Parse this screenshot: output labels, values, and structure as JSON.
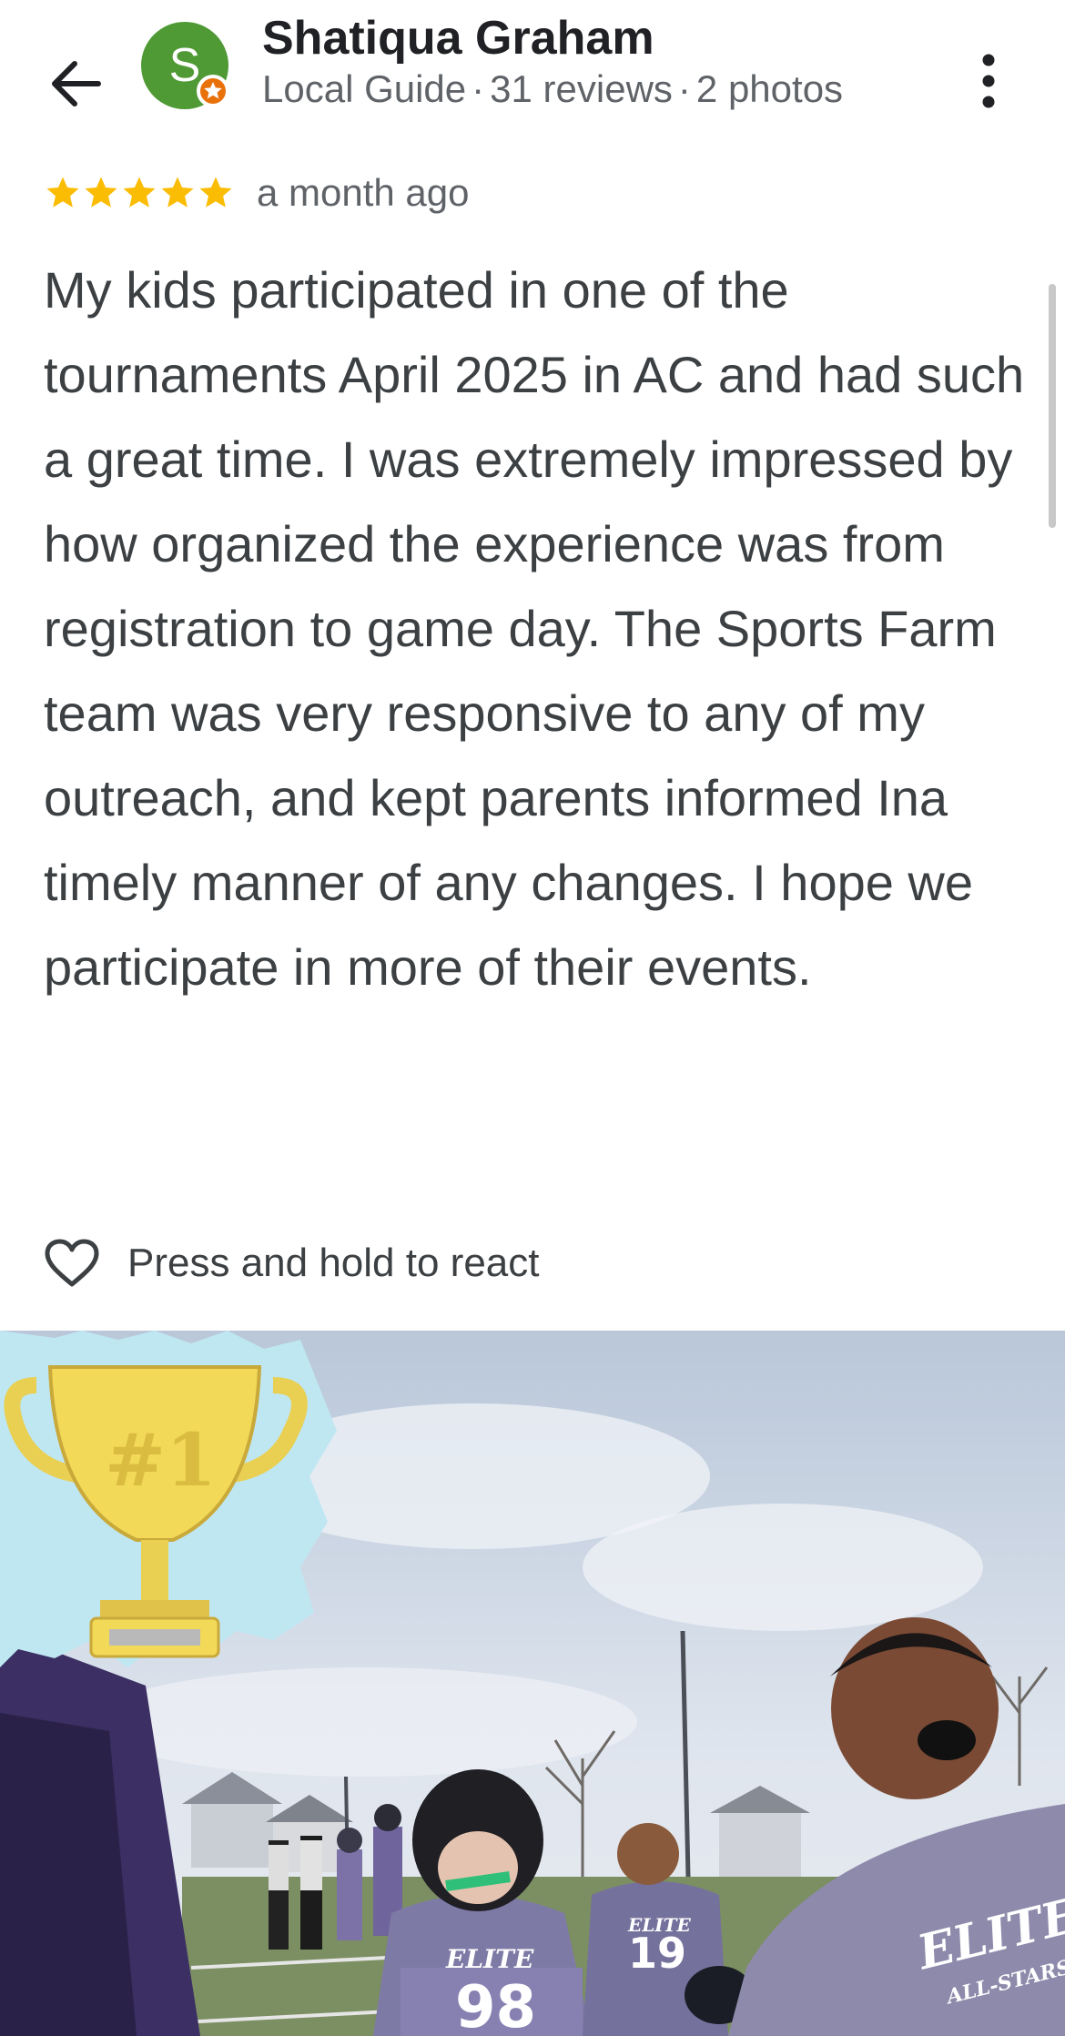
{
  "header": {
    "avatar_letter": "S",
    "name": "Shatiqua Graham",
    "level": "Local Guide",
    "reviews": "31 reviews",
    "photos": "2 photos",
    "back_icon": "arrow-left-icon",
    "more_icon": "more-vert-icon",
    "avatar_color": "#4f9a35",
    "badge_color": "#e8710a"
  },
  "review": {
    "rating": 5,
    "star_color": "#fbbc04",
    "date": "a month ago",
    "text": "My kids participated in one of the tournaments April 2025 in AC and had such a great time. I was extremely impressed by how organized the experience was from registration to game day. The Sports Farm team was very responsive to any of my outreach, and kept parents informed Ina timely manner of any changes. I hope we participate in more of their events.",
    "react_label": "Press and hold to react",
    "react_icon": "heart-outline-icon"
  },
  "photo": {
    "trophy_text": "#1",
    "jersey_team": "ELITE",
    "jersey_sub": "ALL-STARS",
    "jersey_numbers": [
      "98",
      "19"
    ]
  }
}
